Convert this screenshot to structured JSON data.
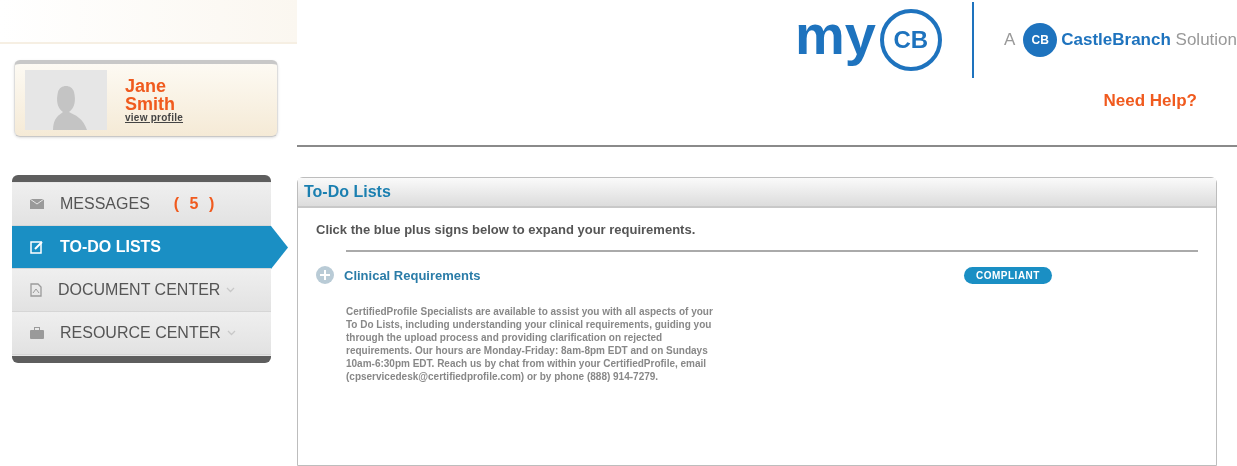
{
  "profile": {
    "name_first": "Jane",
    "name_last": "Smith",
    "link": "view profile"
  },
  "header": {
    "logo_my": "my",
    "logo_mark": "CB",
    "tagline_prefix": "A",
    "brand_mark": "CB",
    "brand_bold": "CastleBranch",
    "brand_rest": "Solution",
    "help": "Need Help?"
  },
  "nav": [
    {
      "label": "MESSAGES",
      "kind": "mail",
      "count": "( 5 )",
      "selected": false,
      "caret": false
    },
    {
      "label": "TO-DO LISTS",
      "kind": "edit",
      "selected": true,
      "caret": false
    },
    {
      "label": "DOCUMENT CENTER",
      "kind": "document",
      "selected": false,
      "caret": true
    },
    {
      "label": "RESOURCE CENTER",
      "kind": "briefcase",
      "selected": false,
      "caret": true
    }
  ],
  "panel": {
    "title": "To-Do Lists",
    "instruction": "Click the blue plus signs below to expand your requirements.",
    "sections": [
      {
        "title": "Clinical Requirements",
        "status": "COMPLIANT",
        "expanded": false
      }
    ],
    "note": "CertifiedProfile Specialists are available to assist you with all aspects of your To Do Lists, including understanding your clinical requirements, guiding you through the upload process and providing clarification on rejected requirements. Our hours are Monday-Friday: 8am-8pm EDT and on Sundays 10am-6:30pm EDT. Reach us by chat from within your CertifiedProfile, email (cpservicedesk@certifiedprofile.com) or by phone (888) 914-7279."
  }
}
